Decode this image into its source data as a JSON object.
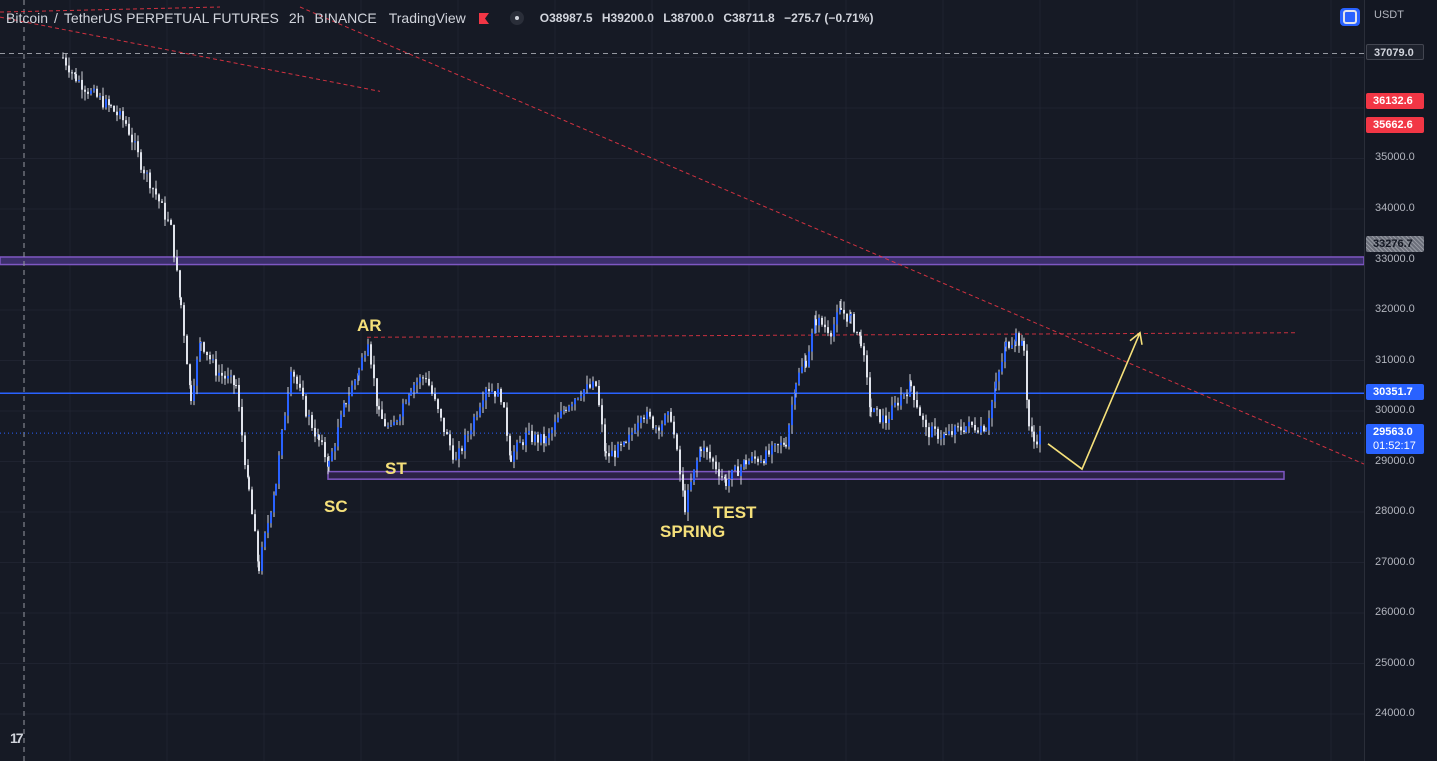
{
  "header": {
    "symbol": "Bitcoin",
    "separator": "/",
    "instrument": "TetherUS PERPETUAL FUTURES",
    "interval": "2h",
    "exchange": "BINANCE",
    "source": "TradingView",
    "ohlc": {
      "open_label": "O",
      "open": "38987.5",
      "high_label": "H",
      "high": "39200.0",
      "low_label": "L",
      "low": "38700.0",
      "close_label": "C",
      "close": "38711.8",
      "change": "−275.7 (−0.71%)"
    }
  },
  "currency": "USDT",
  "colors": {
    "background": "#161a25",
    "candle": "#2962ff",
    "wick": "#d1d4dc",
    "support_band": "#7e57c2",
    "resistance_line": "#2962ff",
    "trendline": "#f23645",
    "annotation": "#f5e07a"
  },
  "chart_data": {
    "type": "candlestick",
    "symbol": "BTCUSDT PERP",
    "interval": "2h",
    "ylim": [
      23300,
      37900
    ],
    "y_ticks": [
      "35000.0",
      "34000.0",
      "33000.0",
      "32000.0",
      "31000.0",
      "30000.0",
      "29000.0",
      "28000.0",
      "27000.0",
      "26000.0",
      "25000.0",
      "24000.0"
    ],
    "price_tags": [
      {
        "value": "37079.0",
        "style": "dark"
      },
      {
        "value": "36132.6",
        "style": "red"
      },
      {
        "value": "35662.6",
        "style": "red"
      },
      {
        "value": "33276.7",
        "style": "gray"
      },
      {
        "value": "30351.7",
        "style": "blue"
      },
      {
        "value": "29563.0",
        "countdown": "01:52:17",
        "style": "blue"
      }
    ],
    "levels": {
      "resistance_band": [
        32900,
        33050
      ],
      "support_band": [
        28650,
        28800
      ],
      "blue_line": 30351.7,
      "ar_level": 31450,
      "crosshair_price": 37079.0,
      "last_price": 29563.0
    },
    "wyckoff_labels": [
      "SC",
      "AR",
      "ST",
      "SPRING",
      "TEST"
    ],
    "path": [
      [
        62,
        37000
      ],
      [
        75,
        36600
      ],
      [
        90,
        36300
      ],
      [
        110,
        36000
      ],
      [
        125,
        35700
      ],
      [
        140,
        34900
      ],
      [
        155,
        34300
      ],
      [
        170,
        33600
      ],
      [
        180,
        32100
      ],
      [
        190,
        30300
      ],
      [
        200,
        31400
      ],
      [
        215,
        30800
      ],
      [
        235,
        30500
      ],
      [
        248,
        28400
      ],
      [
        258,
        26900
      ],
      [
        275,
        28600
      ],
      [
        290,
        30900
      ],
      [
        305,
        30000
      ],
      [
        318,
        29400
      ],
      [
        328,
        28950
      ],
      [
        345,
        30200
      ],
      [
        358,
        30800
      ],
      [
        367,
        31450
      ],
      [
        378,
        29900
      ],
      [
        390,
        29600
      ],
      [
        410,
        30500
      ],
      [
        425,
        30700
      ],
      [
        440,
        29800
      ],
      [
        455,
        29000
      ],
      [
        470,
        29700
      ],
      [
        485,
        30500
      ],
      [
        500,
        30300
      ],
      [
        510,
        29100
      ],
      [
        525,
        29500
      ],
      [
        545,
        29400
      ],
      [
        565,
        30100
      ],
      [
        580,
        30400
      ],
      [
        595,
        30500
      ],
      [
        605,
        29100
      ],
      [
        625,
        29300
      ],
      [
        640,
        30000
      ],
      [
        655,
        29700
      ],
      [
        670,
        29900
      ],
      [
        684,
        28100
      ],
      [
        700,
        29300
      ],
      [
        715,
        28900
      ],
      [
        725,
        28600
      ],
      [
        745,
        29000
      ],
      [
        765,
        29100
      ],
      [
        785,
        29400
      ],
      [
        795,
        30600
      ],
      [
        805,
        31000
      ],
      [
        815,
        31800
      ],
      [
        830,
        31600
      ],
      [
        840,
        32000
      ],
      [
        850,
        31800
      ],
      [
        860,
        31400
      ],
      [
        870,
        30000
      ],
      [
        885,
        29800
      ],
      [
        900,
        30300
      ],
      [
        910,
        30500
      ],
      [
        925,
        29600
      ],
      [
        945,
        29500
      ],
      [
        965,
        29700
      ],
      [
        985,
        29700
      ],
      [
        995,
        30500
      ],
      [
        1005,
        31300
      ],
      [
        1015,
        31500
      ],
      [
        1023,
        31200
      ],
      [
        1028,
        29700
      ],
      [
        1033,
        29400
      ],
      [
        1040,
        29550
      ]
    ],
    "projection": [
      [
        1048,
        29350
      ],
      [
        1082,
        28850
      ],
      [
        1140,
        31550
      ]
    ],
    "trendlines": [
      {
        "from": [
          0,
          37800
        ],
        "to": [
          380,
          36330
        ]
      },
      {
        "from": [
          0,
          37900
        ],
        "to": [
          220,
          38000
        ]
      },
      {
        "from": [
          300,
          38000
        ],
        "to": [
          1364,
          28950
        ]
      }
    ]
  },
  "annotations": {
    "sc": "SC",
    "ar": "AR",
    "st": "ST",
    "spring": "SPRING",
    "test": "TEST"
  }
}
